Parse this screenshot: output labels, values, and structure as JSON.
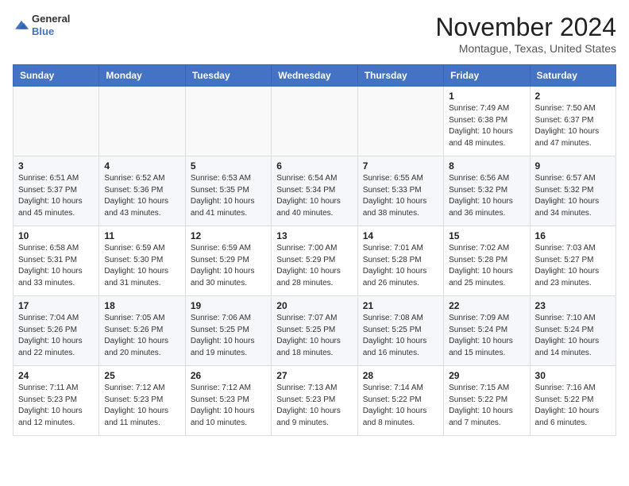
{
  "header": {
    "logo": {
      "line1": "General",
      "line2": "Blue"
    },
    "title": "November 2024",
    "location": "Montague, Texas, United States"
  },
  "weekdays": [
    "Sunday",
    "Monday",
    "Tuesday",
    "Wednesday",
    "Thursday",
    "Friday",
    "Saturday"
  ],
  "weeks": [
    [
      {
        "day": "",
        "info": ""
      },
      {
        "day": "",
        "info": ""
      },
      {
        "day": "",
        "info": ""
      },
      {
        "day": "",
        "info": ""
      },
      {
        "day": "",
        "info": ""
      },
      {
        "day": "1",
        "info": "Sunrise: 7:49 AM\nSunset: 6:38 PM\nDaylight: 10 hours\nand 48 minutes."
      },
      {
        "day": "2",
        "info": "Sunrise: 7:50 AM\nSunset: 6:37 PM\nDaylight: 10 hours\nand 47 minutes."
      }
    ],
    [
      {
        "day": "3",
        "info": "Sunrise: 6:51 AM\nSunset: 5:37 PM\nDaylight: 10 hours\nand 45 minutes."
      },
      {
        "day": "4",
        "info": "Sunrise: 6:52 AM\nSunset: 5:36 PM\nDaylight: 10 hours\nand 43 minutes."
      },
      {
        "day": "5",
        "info": "Sunrise: 6:53 AM\nSunset: 5:35 PM\nDaylight: 10 hours\nand 41 minutes."
      },
      {
        "day": "6",
        "info": "Sunrise: 6:54 AM\nSunset: 5:34 PM\nDaylight: 10 hours\nand 40 minutes."
      },
      {
        "day": "7",
        "info": "Sunrise: 6:55 AM\nSunset: 5:33 PM\nDaylight: 10 hours\nand 38 minutes."
      },
      {
        "day": "8",
        "info": "Sunrise: 6:56 AM\nSunset: 5:32 PM\nDaylight: 10 hours\nand 36 minutes."
      },
      {
        "day": "9",
        "info": "Sunrise: 6:57 AM\nSunset: 5:32 PM\nDaylight: 10 hours\nand 34 minutes."
      }
    ],
    [
      {
        "day": "10",
        "info": "Sunrise: 6:58 AM\nSunset: 5:31 PM\nDaylight: 10 hours\nand 33 minutes."
      },
      {
        "day": "11",
        "info": "Sunrise: 6:59 AM\nSunset: 5:30 PM\nDaylight: 10 hours\nand 31 minutes."
      },
      {
        "day": "12",
        "info": "Sunrise: 6:59 AM\nSunset: 5:29 PM\nDaylight: 10 hours\nand 30 minutes."
      },
      {
        "day": "13",
        "info": "Sunrise: 7:00 AM\nSunset: 5:29 PM\nDaylight: 10 hours\nand 28 minutes."
      },
      {
        "day": "14",
        "info": "Sunrise: 7:01 AM\nSunset: 5:28 PM\nDaylight: 10 hours\nand 26 minutes."
      },
      {
        "day": "15",
        "info": "Sunrise: 7:02 AM\nSunset: 5:28 PM\nDaylight: 10 hours\nand 25 minutes."
      },
      {
        "day": "16",
        "info": "Sunrise: 7:03 AM\nSunset: 5:27 PM\nDaylight: 10 hours\nand 23 minutes."
      }
    ],
    [
      {
        "day": "17",
        "info": "Sunrise: 7:04 AM\nSunset: 5:26 PM\nDaylight: 10 hours\nand 22 minutes."
      },
      {
        "day": "18",
        "info": "Sunrise: 7:05 AM\nSunset: 5:26 PM\nDaylight: 10 hours\nand 20 minutes."
      },
      {
        "day": "19",
        "info": "Sunrise: 7:06 AM\nSunset: 5:25 PM\nDaylight: 10 hours\nand 19 minutes."
      },
      {
        "day": "20",
        "info": "Sunrise: 7:07 AM\nSunset: 5:25 PM\nDaylight: 10 hours\nand 18 minutes."
      },
      {
        "day": "21",
        "info": "Sunrise: 7:08 AM\nSunset: 5:25 PM\nDaylight: 10 hours\nand 16 minutes."
      },
      {
        "day": "22",
        "info": "Sunrise: 7:09 AM\nSunset: 5:24 PM\nDaylight: 10 hours\nand 15 minutes."
      },
      {
        "day": "23",
        "info": "Sunrise: 7:10 AM\nSunset: 5:24 PM\nDaylight: 10 hours\nand 14 minutes."
      }
    ],
    [
      {
        "day": "24",
        "info": "Sunrise: 7:11 AM\nSunset: 5:23 PM\nDaylight: 10 hours\nand 12 minutes."
      },
      {
        "day": "25",
        "info": "Sunrise: 7:12 AM\nSunset: 5:23 PM\nDaylight: 10 hours\nand 11 minutes."
      },
      {
        "day": "26",
        "info": "Sunrise: 7:12 AM\nSunset: 5:23 PM\nDaylight: 10 hours\nand 10 minutes."
      },
      {
        "day": "27",
        "info": "Sunrise: 7:13 AM\nSunset: 5:23 PM\nDaylight: 10 hours\nand 9 minutes."
      },
      {
        "day": "28",
        "info": "Sunrise: 7:14 AM\nSunset: 5:22 PM\nDaylight: 10 hours\nand 8 minutes."
      },
      {
        "day": "29",
        "info": "Sunrise: 7:15 AM\nSunset: 5:22 PM\nDaylight: 10 hours\nand 7 minutes."
      },
      {
        "day": "30",
        "info": "Sunrise: 7:16 AM\nSunset: 5:22 PM\nDaylight: 10 hours\nand 6 minutes."
      }
    ]
  ]
}
